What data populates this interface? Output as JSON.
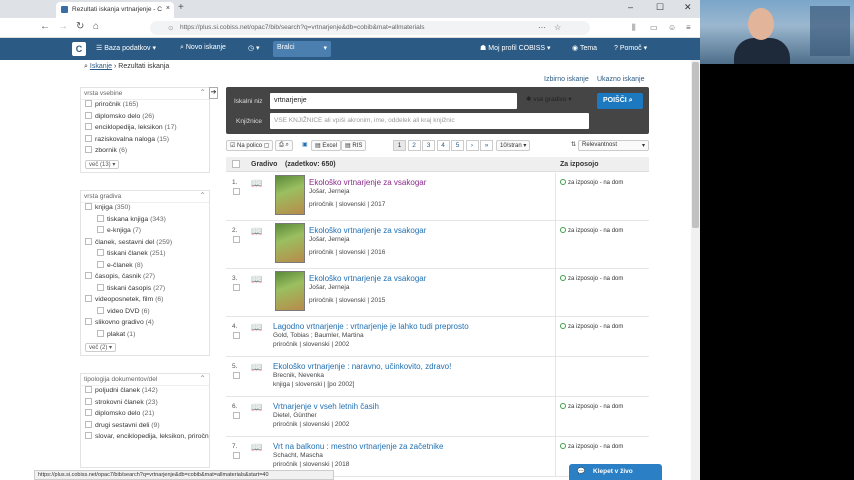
{
  "browser": {
    "tab_title": "Rezultati iskanja vrtnarjenje - C",
    "url_host": "https://plus.si.cobiss.net",
    "url_path": "/opac7/bib/search?q=vrtnarjenje&db=cobib&mat=allmaterials",
    "status_url": "https://plus.si.cobiss.net/opac7/bib/search?q=vrtnarjenje&db=cobib&mat=allmaterials&start=40"
  },
  "nav": {
    "baza": "Baza podatkov",
    "novo": "Novo iskanje",
    "bralci": "Bralci",
    "profil": "Moj profil COBISS",
    "tema": "Tema",
    "pomoc": "Pomoč"
  },
  "crumb": {
    "home": "Iskanje",
    "current": "Rezultati iskanja"
  },
  "links": {
    "advanced": "Izbirno iskanje",
    "help": "Ukazno iskanje"
  },
  "search": {
    "label": "Iskalni niz",
    "query": "vrtnarjenje",
    "scope": "vse gradivo",
    "button": "POIŠČI",
    "lib_label": "Knjižnice",
    "lib_placeholder": "VSE KNJIŽNICE ali vpiši akronim, ime, oddelek ali kraj knjižnic"
  },
  "toolbar": {
    "print": "Na polico",
    "excel": "Excel",
    "ris": "RIS",
    "perpage": "10/stran",
    "sort": "Relevantnost"
  },
  "pages": [
    "1",
    "2",
    "3",
    "4",
    "5",
    "›",
    "»"
  ],
  "facets": {
    "vrsta_vsebine": {
      "title": "vrsta vsebine",
      "items": [
        {
          "label": "priročnik",
          "count": "(165)"
        },
        {
          "label": "diplomsko delo",
          "count": "(26)"
        },
        {
          "label": "enciklopedija, leksikon",
          "count": "(17)"
        },
        {
          "label": "raziskovalna naloga",
          "count": "(15)"
        },
        {
          "label": "zbornik",
          "count": "(6)"
        }
      ],
      "more": "več (13) ▾"
    },
    "vrsta_gradiva": {
      "title": "vrsta gradiva",
      "items": [
        {
          "label": "knjiga",
          "count": "(350)",
          "l2": false
        },
        {
          "label": "tiskana knjiga",
          "count": "(343)",
          "l2": true
        },
        {
          "label": "e-knjiga",
          "count": "(7)",
          "l2": true
        },
        {
          "label": "članek, sestavni del",
          "count": "(259)",
          "l2": false
        },
        {
          "label": "tiskani članek",
          "count": "(251)",
          "l2": true
        },
        {
          "label": "e-članek",
          "count": "(8)",
          "l2": true
        },
        {
          "label": "časopis, časnik",
          "count": "(27)",
          "l2": false
        },
        {
          "label": "tiskani časopis",
          "count": "(27)",
          "l2": true
        },
        {
          "label": "videoposnetek, film",
          "count": "(6)",
          "l2": false
        },
        {
          "label": "video DVD",
          "count": "(6)",
          "l2": true
        },
        {
          "label": "slikovno gradivo",
          "count": "(4)",
          "l2": false
        },
        {
          "label": "plakat",
          "count": "(1)",
          "l2": true
        }
      ],
      "more": "več (2) ▾"
    },
    "tipologija": {
      "title": "tipologija dokumentov/del",
      "items": [
        {
          "label": "poljudni članek",
          "count": "(142)"
        },
        {
          "label": "strokovni članek",
          "count": "(23)"
        },
        {
          "label": "diplomsko delo",
          "count": "(21)"
        },
        {
          "label": "drugi sestavni deli",
          "count": "(9)"
        },
        {
          "label": "slovar, enciklopedija, leksikon, priročnik, atlas, zemljevid",
          "count": "(8)"
        }
      ]
    }
  },
  "results": {
    "col_gradivo": "Gradivo",
    "count": "(zadetkov: 650)",
    "col_avail": "Za izposojo",
    "items": [
      {
        "num": "1.",
        "title": "Ekološko vrtnarjenje za vsakogar",
        "author": "Jošar, Jerneja",
        "meta": "priročnik | slovenski | 2017",
        "avail": "za izposojo - na dom",
        "cover": true,
        "visited": true
      },
      {
        "num": "2.",
        "title": "Ekološko vrtnarjenje za vsakogar",
        "author": "Jošar, Jerneja",
        "meta": "priročnik | slovenski | 2016",
        "avail": "za izposojo - na dom",
        "cover": true,
        "visited": false
      },
      {
        "num": "3.",
        "title": "Ekološko vrtnarjenje za vsakogar",
        "author": "Jošar, Jerneja",
        "meta": "priročnik | slovenski | 2015",
        "avail": "za izposojo - na dom",
        "cover": true,
        "visited": false
      },
      {
        "num": "4.",
        "title": "Lagodno vrtnarjenje : vrtnarjenje je lahko tudi preprosto",
        "author": "Gold, Tobias ; Baumler, Martina",
        "meta": "priročnik | slovenski | 2002",
        "avail": "za izposojo - na dom",
        "cover": false,
        "visited": false
      },
      {
        "num": "5.",
        "title": "Ekološko vrtnarjenje : naravno, učinkovito, zdravo!",
        "author": "Brecnik, Nevenka",
        "meta": "knjiga | slovenski | [po 2002]",
        "avail": "",
        "cover": false,
        "visited": false
      },
      {
        "num": "6.",
        "title": "Vrtnarjenje v vseh letnih časih",
        "author": "Dietel, Günther",
        "meta": "priročnik | slovenski | 2002",
        "avail": "za izposojo - na dom",
        "cover": false,
        "visited": false
      },
      {
        "num": "7.",
        "title": "Vrt na balkonu : mestno vrtnarjenje za začetnike",
        "author": "Schacht, Mascha",
        "meta": "priročnik | slovenski | 2018",
        "avail": "za izposojo - na dom",
        "cover": false,
        "visited": false
      }
    ]
  },
  "chat": "Klepet v živo",
  "colors": {
    "nav": "#2b5b84",
    "visited": "#8a2a8a",
    "link": "#1f6fb2",
    "button": "#1c79c0"
  }
}
